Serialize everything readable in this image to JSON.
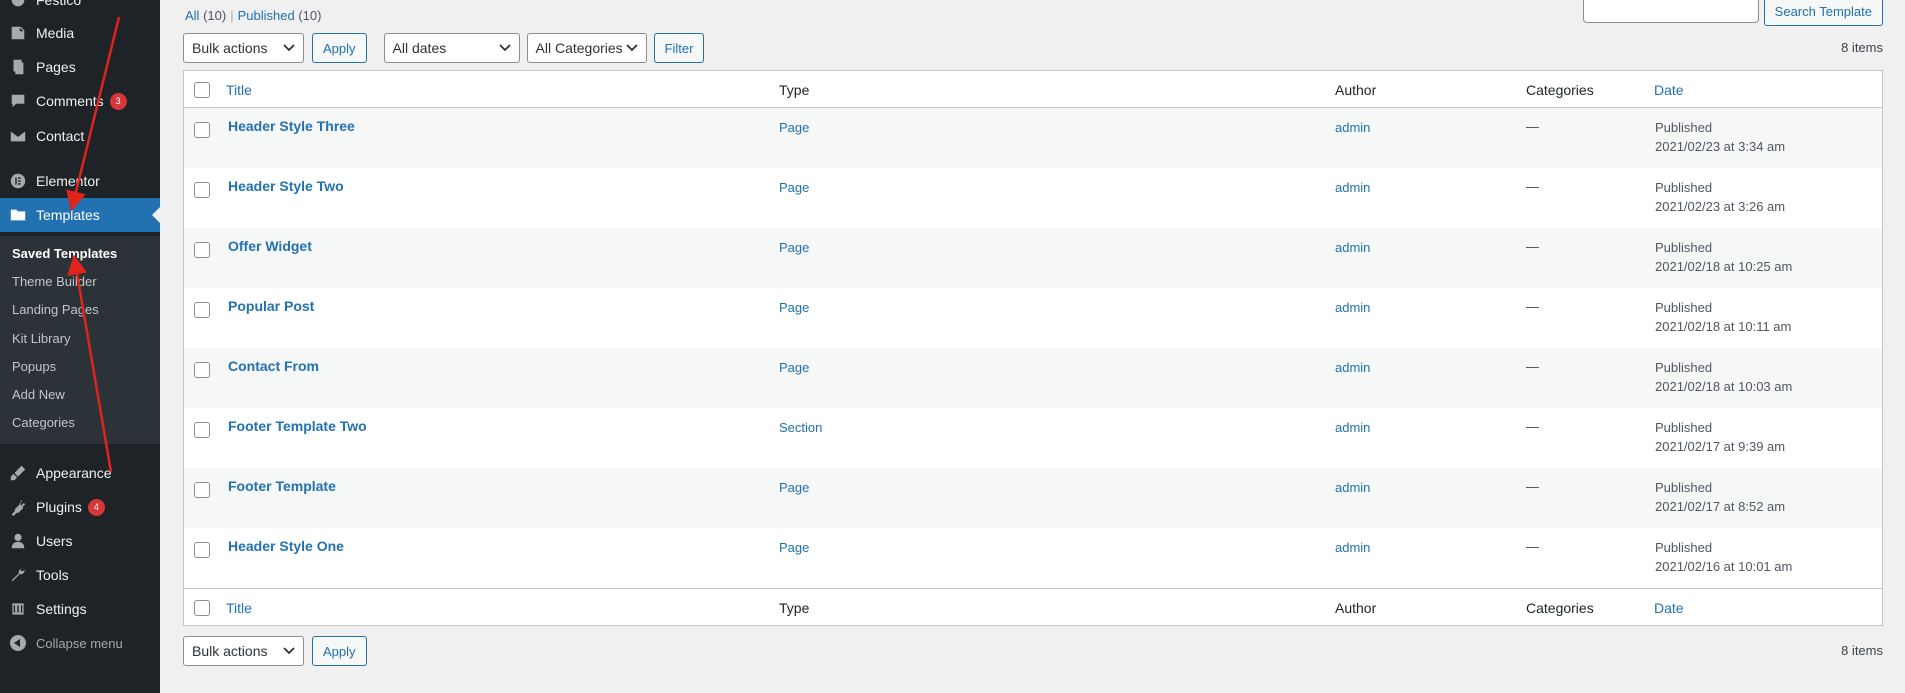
{
  "sidebar": {
    "top_partial": "Festico",
    "items": [
      {
        "label": "Media",
        "icon": "media-icon"
      },
      {
        "label": "Pages",
        "icon": "pages-icon"
      },
      {
        "label": "Comments",
        "icon": "comments-icon",
        "badge": "3"
      },
      {
        "label": "Contact",
        "icon": "mail-icon"
      },
      {
        "label": "Elementor",
        "icon": "elementor-icon"
      },
      {
        "label": "Templates",
        "icon": "folder-icon"
      },
      {
        "label": "Appearance",
        "icon": "brush-icon"
      },
      {
        "label": "Plugins",
        "icon": "plug-icon",
        "badge": "4"
      },
      {
        "label": "Users",
        "icon": "user-icon"
      },
      {
        "label": "Tools",
        "icon": "wrench-icon"
      },
      {
        "label": "Settings",
        "icon": "settings-icon"
      }
    ],
    "submenu": [
      "Saved Templates",
      "Theme Builder",
      "Landing Pages",
      "Kit Library",
      "Popups",
      "Add New",
      "Categories"
    ],
    "collapse_label": "Collapse menu"
  },
  "filters": {
    "all_label": "All",
    "all_count": "(10)",
    "published_label": "Published",
    "published_count": "(10)"
  },
  "search": {
    "button_label": "Search Template",
    "value": ""
  },
  "tablenav": {
    "bulk_actions": "Bulk actions",
    "apply": "Apply",
    "dates": "All dates",
    "categories": "All Categories",
    "filter": "Filter",
    "items_count": "8 items"
  },
  "table": {
    "columns": [
      "Title",
      "Type",
      "Author",
      "Categories",
      "Date"
    ],
    "rows": [
      {
        "title": "Header Style Three",
        "type": "Page",
        "author": "admin",
        "categories": "—",
        "status": "Published",
        "date": "2021/02/23 at 3:34 am"
      },
      {
        "title": "Header Style Two",
        "type": "Page",
        "author": "admin",
        "categories": "—",
        "status": "Published",
        "date": "2021/02/23 at 3:26 am"
      },
      {
        "title": "Offer Widget",
        "type": "Page",
        "author": "admin",
        "categories": "—",
        "status": "Published",
        "date": "2021/02/18 at 10:25 am"
      },
      {
        "title": "Popular Post",
        "type": "Page",
        "author": "admin",
        "categories": "—",
        "status": "Published",
        "date": "2021/02/18 at 10:11 am"
      },
      {
        "title": "Contact From",
        "type": "Page",
        "author": "admin",
        "categories": "—",
        "status": "Published",
        "date": "2021/02/18 at 10:03 am"
      },
      {
        "title": "Footer Template Two",
        "type": "Section",
        "author": "admin",
        "categories": "—",
        "status": "Published",
        "date": "2021/02/17 at 9:39 am"
      },
      {
        "title": "Footer Template",
        "type": "Page",
        "author": "admin",
        "categories": "—",
        "status": "Published",
        "date": "2021/02/17 at 8:52 am"
      },
      {
        "title": "Header Style One",
        "type": "Page",
        "author": "admin",
        "categories": "—",
        "status": "Published",
        "date": "2021/02/16 at 10:01 am"
      }
    ]
  },
  "colors": {
    "sidebar_bg": "#1d2327",
    "submenu_bg": "#2c3338",
    "accent": "#2271b1",
    "badge": "#d63638",
    "arrow": "#e0241b"
  }
}
